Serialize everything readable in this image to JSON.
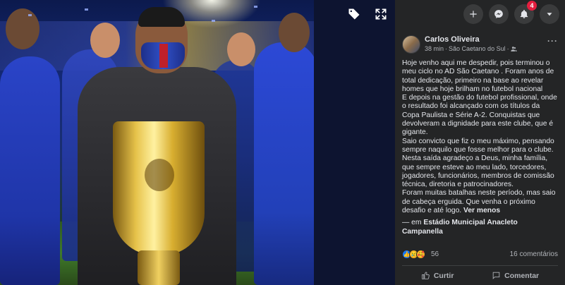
{
  "topbar": {
    "notification_count": "4",
    "buttons": [
      "add-icon",
      "messenger-icon",
      "bell-icon",
      "caret-down-icon"
    ]
  },
  "photo_overlay": {
    "icons": [
      "tag-icon",
      "expand-icon"
    ]
  },
  "post": {
    "author": "Carlos Oliveira",
    "time": "38 min",
    "separator": "·",
    "location": "São Caetano do Sul",
    "audience_icon": "friends-icon",
    "more_label": "···",
    "body_paragraphs": [
      "Hoje venho aqui me despedir, pois terminou o meu ciclo no AD São Caetano . Foram anos de total dedicação, primeiro na base ao revelar homes que hoje brilham no futebol nacional",
      "E depois na gestão do futebol profissional, onde o resultado foi alcançado com os títulos da Copa Paulista e Série A-2. Conquistas que devolveram a dignidade para este clube, que é gigante.",
      "Saio convicto que fiz o meu máximo, pensando sempre naquilo que fosse melhor para o clube.",
      "Nesta saída agradeço a Deus, minha família, que sempre esteve ao meu lado, torcedores, jogadores, funcionários, membros de comissão técnica, diretoria e patrocinadores.",
      "Foram muitas batalhas neste período, mas saio de cabeça erguida. Que venha o próximo desafio e até logo."
    ],
    "see_less": "Ver menos",
    "checkin_prefix": "— em",
    "checkin_place": "Estádio Municipal Anacleto Campanella",
    "reaction_count": "56",
    "comments_label": "16 comentários",
    "like_label": "Curtir",
    "comment_label": "Comentar"
  },
  "colors": {
    "panel_bg": "#242526",
    "text_primary": "#e4e6eb",
    "text_secondary": "#b0b3b8",
    "badge": "#e41e3f",
    "like_blue": "#1877f2"
  }
}
